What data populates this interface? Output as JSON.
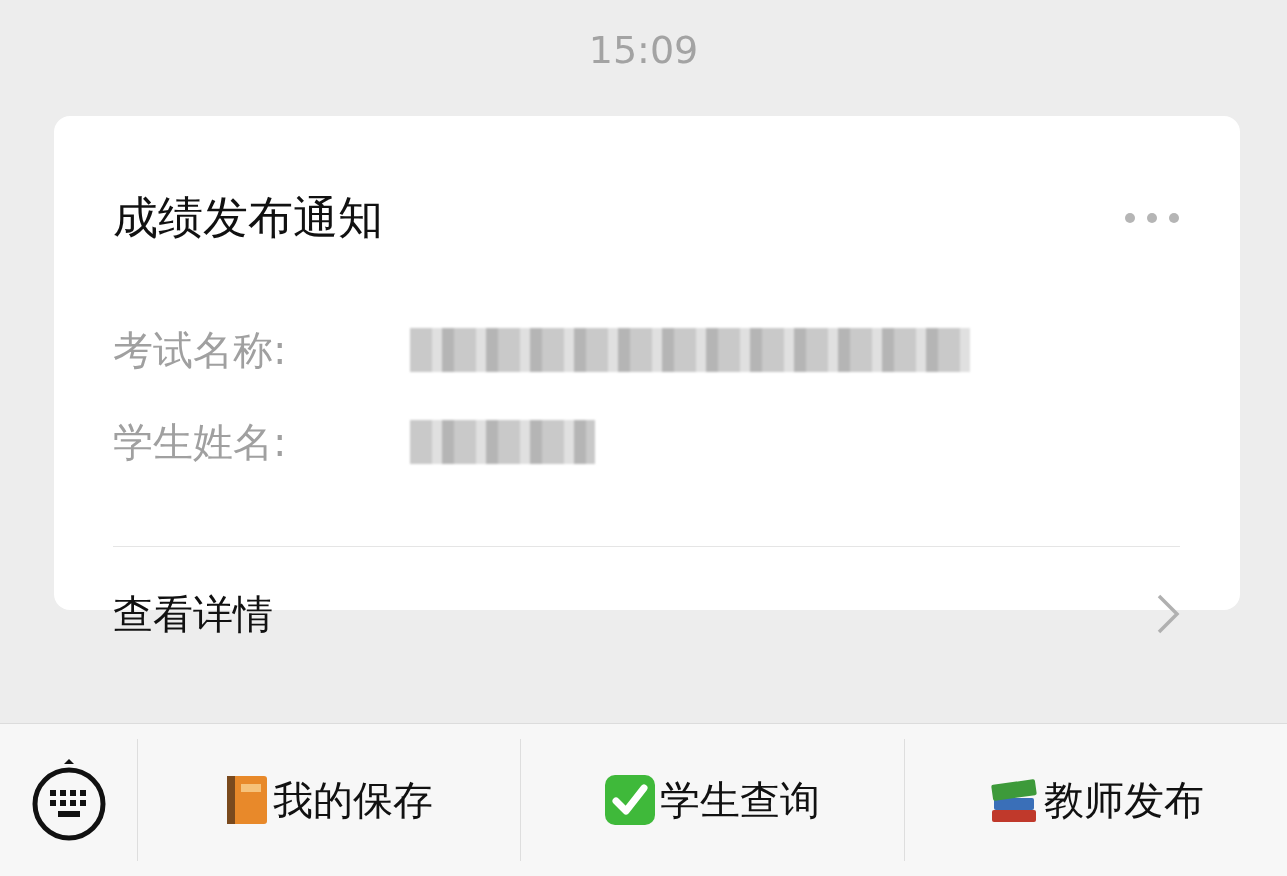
{
  "timestamp": "15:09",
  "card": {
    "title": "成绩发布通知",
    "fields": [
      {
        "label": "考试名称:",
        "value_redacted": true
      },
      {
        "label": "学生姓名:",
        "value_redacted": true
      }
    ],
    "link": "查看详情"
  },
  "menu": [
    {
      "kind": "book",
      "label": "我的保存"
    },
    {
      "kind": "check",
      "label": "学生查询"
    },
    {
      "kind": "books",
      "label": "教师发布"
    }
  ]
}
